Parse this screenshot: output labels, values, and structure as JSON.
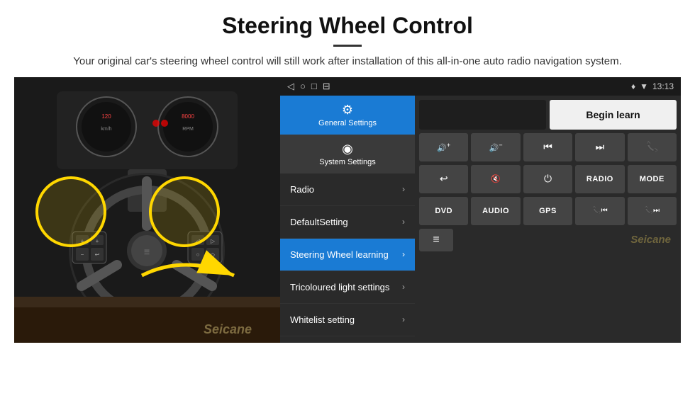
{
  "header": {
    "title": "Steering Wheel Control",
    "divider": true,
    "subtitle": "Your original car's steering wheel control will still work after installation of this all-in-one auto radio navigation system."
  },
  "status_bar": {
    "icons": [
      "◁",
      "○",
      "□",
      "⊟"
    ],
    "right_icons": "♦ ▼",
    "time": "13:13"
  },
  "nav": {
    "tabs": [
      {
        "icon": "⚙",
        "label": "General Settings",
        "active": true
      },
      {
        "icon": "◉",
        "label": "System Settings",
        "active": false
      }
    ]
  },
  "menu": {
    "items": [
      {
        "label": "Radio",
        "active": false
      },
      {
        "label": "DefaultSetting",
        "active": false
      },
      {
        "label": "Steering Wheel learning",
        "active": true
      },
      {
        "label": "Tricoloured light settings",
        "active": false
      },
      {
        "label": "Whitelist setting",
        "active": false
      }
    ]
  },
  "controls": {
    "begin_learn_label": "Begin learn",
    "buttons_row1": [
      {
        "icon": "🔊+",
        "label": "vol-up"
      },
      {
        "icon": "🔊−",
        "label": "vol-down"
      },
      {
        "icon": "⏮",
        "label": "prev"
      },
      {
        "icon": "⏭",
        "label": "next"
      },
      {
        "icon": "📞",
        "label": "phone"
      }
    ],
    "buttons_row2": [
      {
        "icon": "↩",
        "label": "hang-up"
      },
      {
        "icon": "🔇",
        "label": "mute"
      },
      {
        "icon": "⏻",
        "label": "power"
      },
      {
        "text": "RADIO",
        "label": "radio"
      },
      {
        "text": "MODE",
        "label": "mode"
      }
    ],
    "buttons_row3": [
      {
        "text": "DVD",
        "label": "dvd"
      },
      {
        "text": "AUDIO",
        "label": "audio"
      },
      {
        "text": "GPS",
        "label": "gps"
      },
      {
        "icon": "📞⏮",
        "label": "phone-prev"
      },
      {
        "icon": "📞⏭",
        "label": "phone-next"
      }
    ]
  },
  "watermark": "Seicane"
}
